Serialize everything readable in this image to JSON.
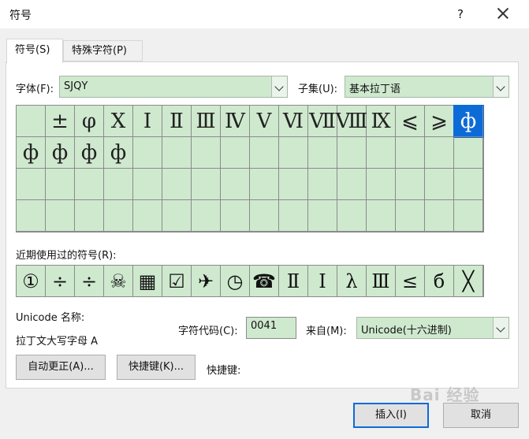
{
  "window": {
    "title": "符号",
    "help": "?"
  },
  "tabs": [
    {
      "label": "符号(S)"
    },
    {
      "label": "特殊字符(P)"
    }
  ],
  "font": {
    "label": "字体(F):",
    "value": "SJQY"
  },
  "subset": {
    "label": "子集(U):",
    "value": "基本拉丁语"
  },
  "symbol_grid": {
    "selected_index": 15,
    "rows": [
      [
        "",
        "±",
        "φ",
        "Ⅹ",
        "Ⅰ",
        "Ⅱ",
        "Ⅲ",
        "Ⅳ",
        "Ⅴ",
        "Ⅵ",
        "Ⅶ",
        "Ⅷ",
        "Ⅸ",
        "⩽",
        "⩾",
        "ф"
      ],
      [
        "ф",
        "ф",
        "ф",
        "ф",
        "",
        "",
        "",
        "",
        "",
        "",
        "",
        "",
        "",
        "",
        "",
        ""
      ],
      [
        "",
        "",
        "",
        "",
        "",
        "",
        "",
        "",
        "",
        "",
        "",
        "",
        "",
        "",
        "",
        ""
      ],
      [
        "",
        "",
        "",
        "",
        "",
        "",
        "",
        "",
        "",
        "",
        "",
        "",
        "",
        "",
        "",
        ""
      ]
    ]
  },
  "recent": {
    "label": "近期使用过的符号(R):",
    "items": [
      "①",
      "÷",
      "÷",
      "☠",
      "▦",
      "☑",
      "✈",
      "◷",
      "☎",
      "Ⅱ",
      "Ⅰ",
      "λ",
      "Ⅲ",
      "≤",
      "б",
      "╳"
    ]
  },
  "unicode_name": {
    "label": "Unicode 名称:",
    "value": "拉丁文大写字母 A"
  },
  "char_code": {
    "label": "字符代码(C):",
    "value": "0041"
  },
  "from": {
    "label": "来自(M):",
    "value": "Unicode(十六进制)"
  },
  "buttons": {
    "autocorrect": "自动更正(A)...",
    "shortcut_key": "快捷键(K)...",
    "shortcut_label": "快捷键:",
    "insert": "插入(I)",
    "cancel": "取消"
  },
  "watermark": "Bai 经验"
}
